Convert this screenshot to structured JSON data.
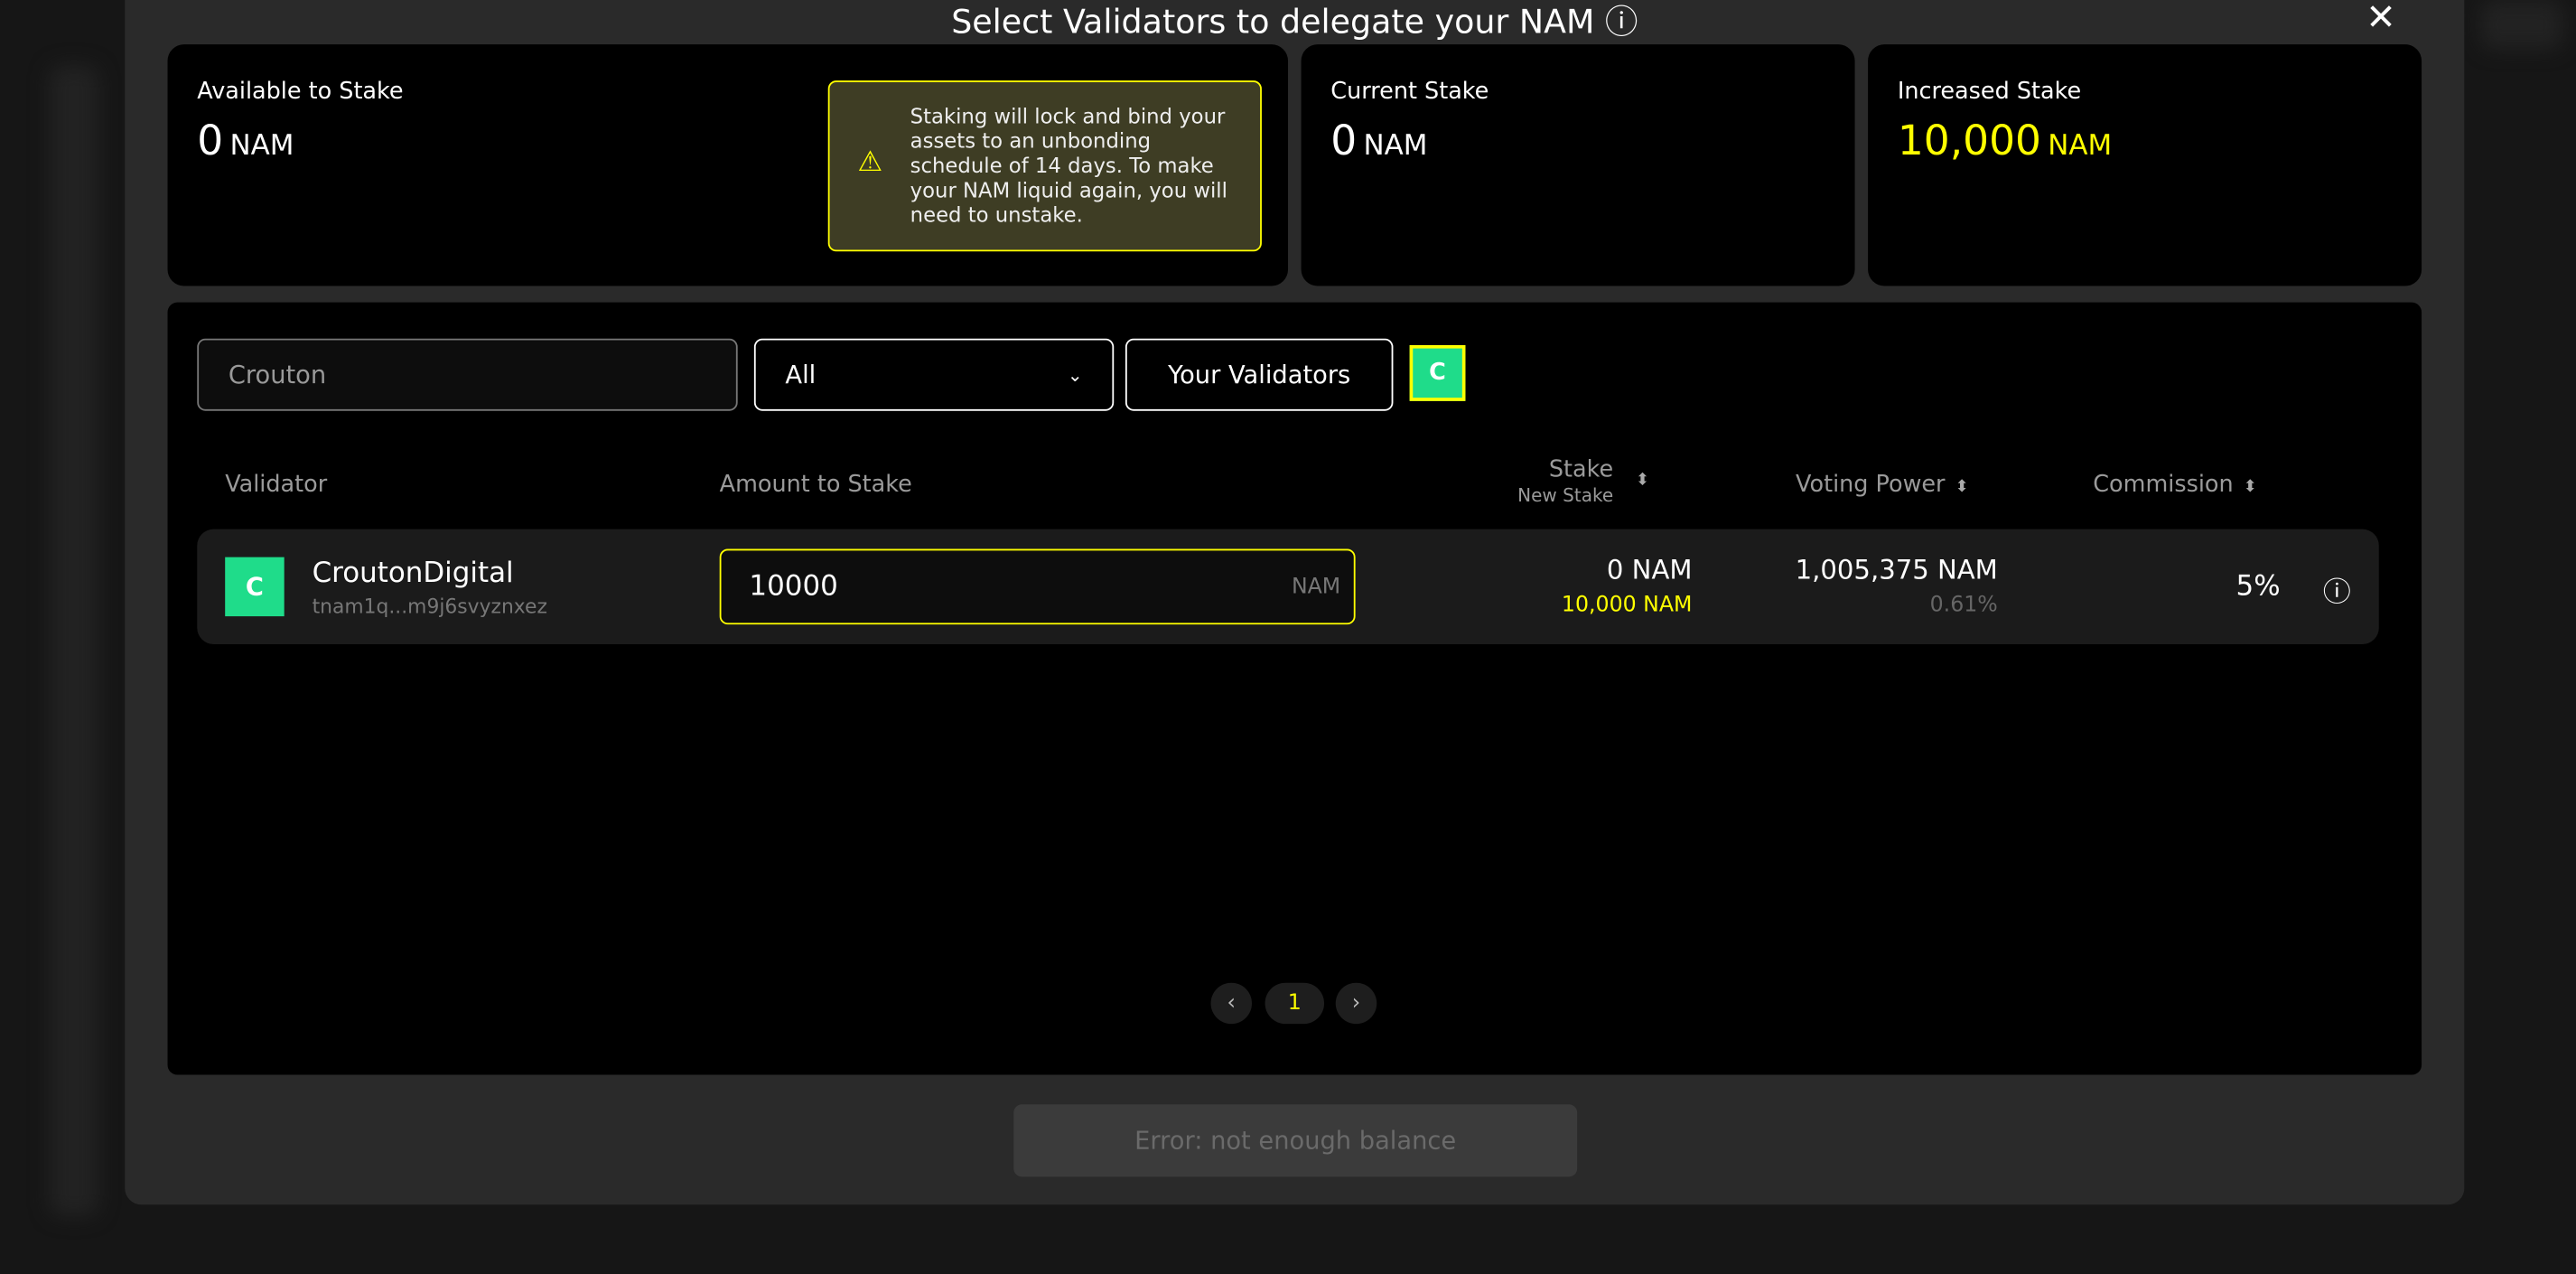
{
  "modal": {
    "title": "Select Validators to delegate your NAM",
    "info_icon": "info-circle-icon",
    "close_icon": "close-x-icon"
  },
  "cards": {
    "available": {
      "label": "Available to Stake",
      "value": "0",
      "unit": "NAM"
    },
    "warning": {
      "icon": "warning-triangle-icon",
      "text": "Staking will lock and bind your assets to an unbonding schedule of 14 days. To make your NAM liquid again, you will need to unstake."
    },
    "current": {
      "label": "Current Stake",
      "value": "0",
      "unit": "NAM"
    },
    "increased": {
      "label": "Increased Stake",
      "value": "10,000",
      "unit": "NAM"
    }
  },
  "filters": {
    "search_value": "Crouton",
    "select_value": "All",
    "your_validators_label": "Your Validators"
  },
  "table": {
    "headers": {
      "validator": "Validator",
      "amount": "Amount to Stake",
      "stake": "Stake",
      "new_stake": "New Stake",
      "voting_power": "Voting Power",
      "commission": "Commission"
    },
    "rows": [
      {
        "name": "CroutonDigital",
        "address": "tnam1q...m9j6svyznxez",
        "amount": "10000",
        "amount_unit": "NAM",
        "stake": "0 NAM",
        "new_stake": "10,000 NAM",
        "voting_power": "1,005,375 NAM",
        "voting_pct": "0.61%",
        "commission": "5%"
      }
    ]
  },
  "pagination": {
    "current": "1",
    "prev_icon": "chevron-left-icon",
    "next_icon": "chevron-right-icon"
  },
  "submit": {
    "label": "Error: not enough balance"
  },
  "colors": {
    "accent": "#ffff00",
    "validator_logo": "#1fdc8a",
    "modal_bg": "#2a2a2a"
  }
}
